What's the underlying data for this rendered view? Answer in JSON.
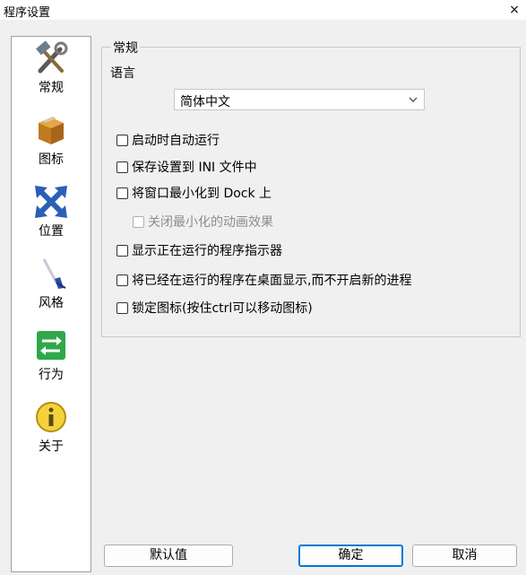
{
  "window": {
    "title": "程序设置",
    "close_glyph": "×"
  },
  "sidebar": {
    "items": [
      {
        "label": "常规",
        "icon": "tools-icon"
      },
      {
        "label": "图标",
        "icon": "box-icon"
      },
      {
        "label": "位置",
        "icon": "move-arrows-icon"
      },
      {
        "label": "风格",
        "icon": "brush-icon"
      },
      {
        "label": "行为",
        "icon": "switch-arrows-icon"
      },
      {
        "label": "关于",
        "icon": "info-icon"
      }
    ]
  },
  "general": {
    "group_title": "常规",
    "language_label": "语言",
    "language_selected": "简体中文",
    "checkboxes": [
      {
        "label": "启动时自动运行",
        "checked": false,
        "enabled": true
      },
      {
        "label": "保存设置到 INI 文件中",
        "checked": false,
        "enabled": true
      },
      {
        "label": "将窗口最小化到 Dock 上",
        "checked": false,
        "enabled": true
      },
      {
        "label": "关闭最小化的动画效果",
        "checked": false,
        "enabled": false
      },
      {
        "label": "显示正在运行的程序指示器",
        "checked": false,
        "enabled": true
      },
      {
        "label": "将已经在运行的程序在桌面显示,而不开启新的进程",
        "checked": false,
        "enabled": true
      },
      {
        "label": "锁定图标(按住ctrl可以移动图标)",
        "checked": false,
        "enabled": true
      }
    ]
  },
  "buttons": {
    "defaults": "默认值",
    "ok": "确定",
    "cancel": "取消"
  },
  "colors": {
    "accent": "#0078d4",
    "background": "#f0f0f0"
  }
}
